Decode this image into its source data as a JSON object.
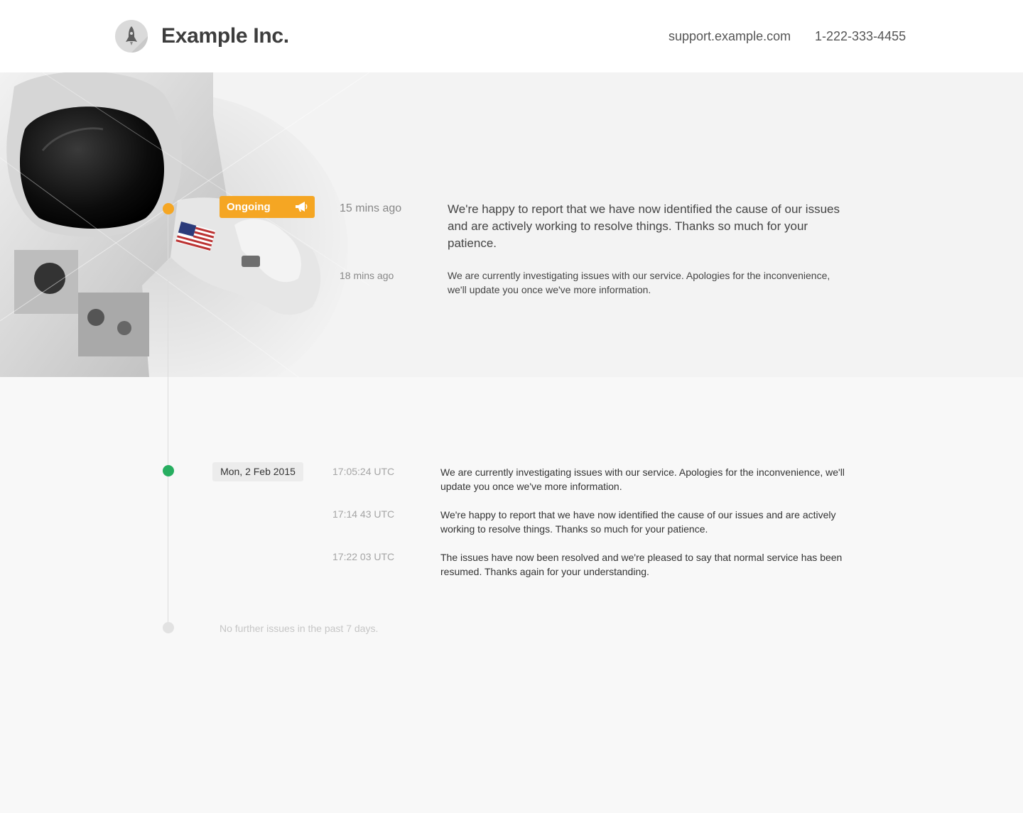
{
  "header": {
    "brand": "Example Inc.",
    "support_link": "support.example.com",
    "phone": "1-222-333-4455"
  },
  "icons": {
    "logo": "rocket-icon",
    "badge": "megaphone-icon"
  },
  "colors": {
    "ongoing": "#f5a623",
    "resolved": "#27ae60",
    "inactive": "#e2e2e2"
  },
  "ongoing": {
    "status_label": "Ongoing",
    "updates": [
      {
        "ago": "15 mins ago",
        "message": "We're happy to report that we have now identified the cause of our issues and are actively working to resolve things. Thanks so much for your patience."
      },
      {
        "ago": "18 mins ago",
        "message": "We are currently investigating issues with our service. Apologies for the inconvenience, we'll update you once we've more information."
      }
    ]
  },
  "history": {
    "date": "Mon, 2 Feb 2015",
    "entries": [
      {
        "time": "17:05:24 UTC",
        "message": "We are currently investigating issues with our service. Apologies for the inconvenience, we'll update you once we've more information."
      },
      {
        "time": "17:14 43 UTC",
        "message": "We're happy to report that we have now identified the cause of our issues and are actively working to resolve things. Thanks so much for your patience."
      },
      {
        "time": "17:22 03 UTC",
        "message": "The issues have now been resolved and we're pleased to say that normal service has been resumed. Thanks again for your understanding."
      }
    ]
  },
  "footer_note": "No further issues in the past 7 days."
}
